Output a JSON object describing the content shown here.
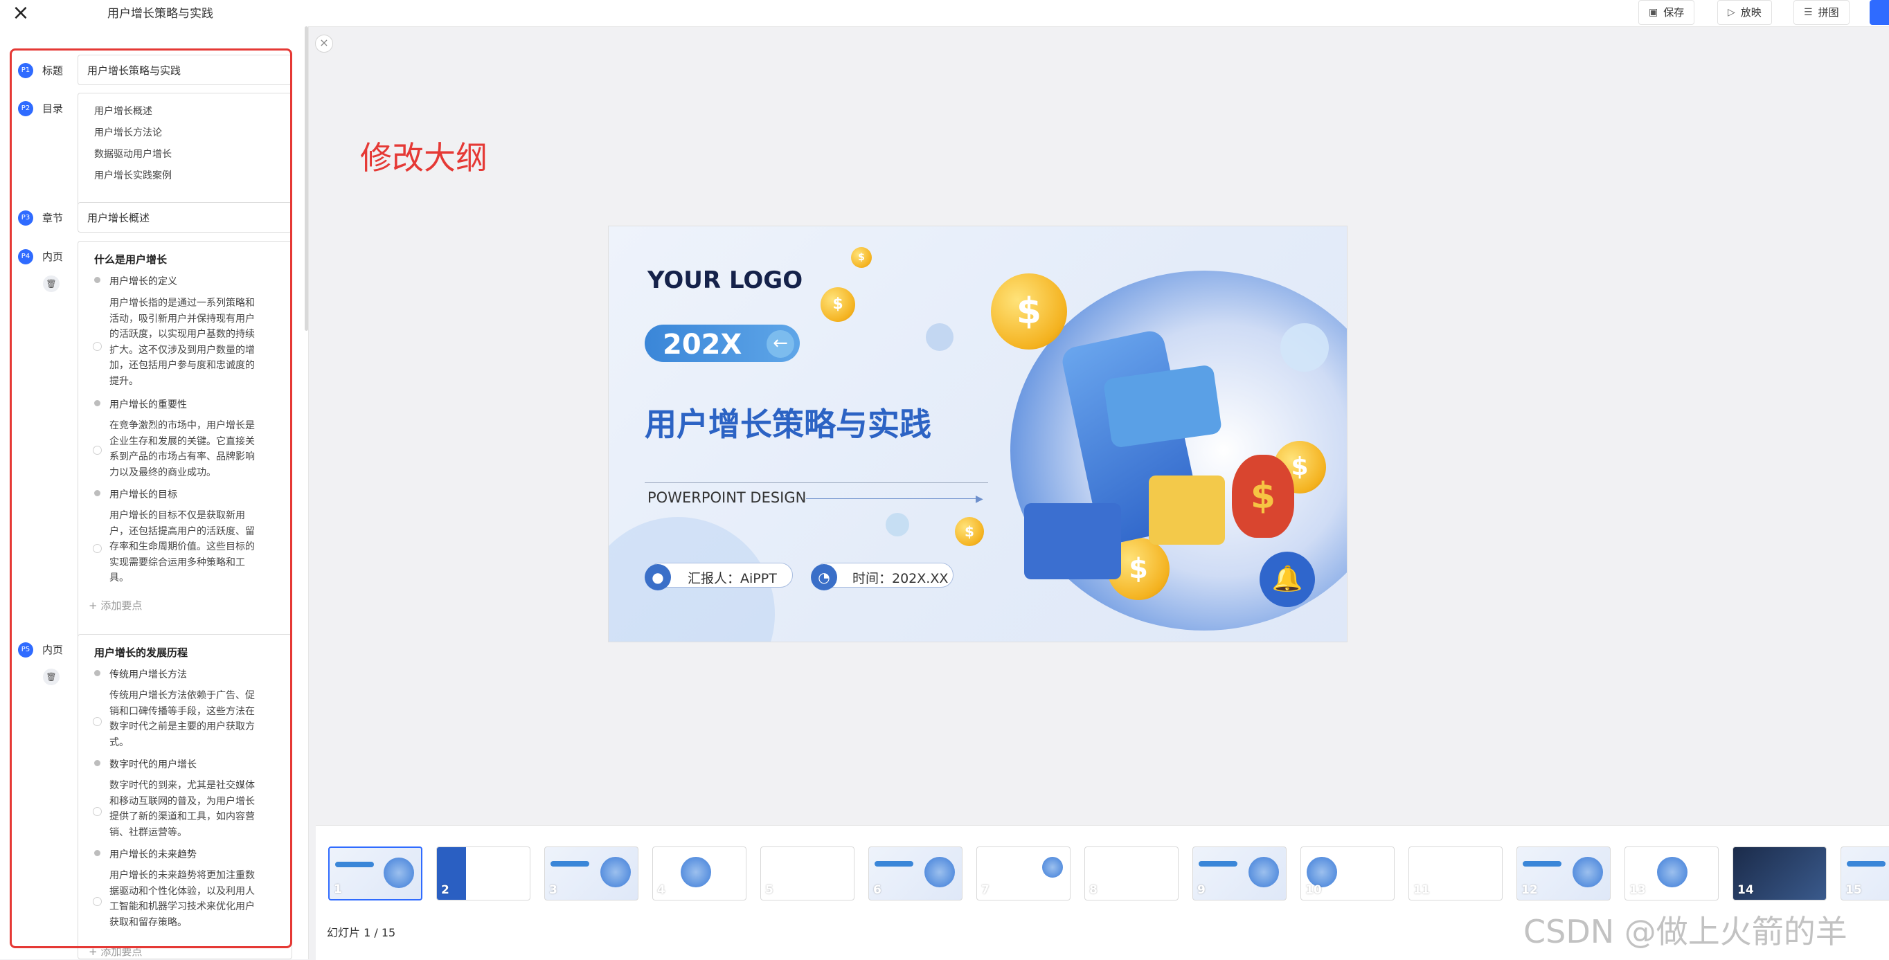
{
  "header": {
    "doc_title": "用户增长策略与实践",
    "buttons": {
      "save": "保存",
      "play": "放映",
      "layout": "拼图"
    }
  },
  "annotation": "修改大纲",
  "outline": {
    "title_item": {
      "badge": "P1",
      "kind": "标题",
      "value": "用户增长策略与实践"
    },
    "toc_item": {
      "badge": "P2",
      "kind": "目录",
      "items": [
        "用户增长概述",
        "用户增长方法论",
        "数据驱动用户增长",
        "用户增长实践案例"
      ]
    },
    "chapter_item": {
      "badge": "P3",
      "kind": "章节",
      "value": "用户增长概述"
    },
    "page4": {
      "badge": "P4",
      "kind": "内页",
      "title": "什么是用户增长",
      "points": [
        {
          "title": "用户增长的定义",
          "desc": [
            "用户增长指的是通过一系列策略和",
            "活动，吸引新用户并保持现有用户",
            "的活跃度，以实现用户基数的持续",
            "扩大。这不仅涉及到用户数量的增",
            "加，还包括用户参与度和忠诚度的",
            "提升。"
          ]
        },
        {
          "title": "用户增长的重要性",
          "desc": [
            "在竞争激烈的市场中，用户增长是",
            "企业生存和发展的关键。它直接关",
            "系到产品的市场占有率、品牌影响",
            "力以及最终的商业成功。"
          ]
        },
        {
          "title": "用户增长的目标",
          "desc": [
            "用户增长的目标不仅是获取新用",
            "户，还包括提高用户的活跃度、留",
            "存率和生命周期价值。这些目标的",
            "实现需要综合运用多种策略和工",
            "具。"
          ]
        }
      ],
      "add_point": "+ 添加要点"
    },
    "page5": {
      "badge": "P5",
      "kind": "内页",
      "title": "用户增长的发展历程",
      "points": [
        {
          "title": "传统用户增长方法",
          "desc": [
            "传统用户增长方法依赖于广告、促",
            "销和口碑传播等手段，这些方法在",
            "数字时代之前是主要的用户获取方",
            "式。"
          ]
        },
        {
          "title": "数字时代的用户增长",
          "desc": [
            "数字时代的到来，尤其是社交媒体",
            "和移动互联网的普及，为用户增长",
            "提供了新的渠道和工具，如内容营",
            "销、社群运营等。"
          ]
        },
        {
          "title": "用户增长的未来趋势",
          "desc": [
            "用户增长的未来趋势将更加注重数",
            "据驱动和个性化体验，以及利用人",
            "工智能和机器学习技术来优化用户",
            "获取和留存策略。"
          ]
        }
      ],
      "add_point": "+ 添加要点"
    }
  },
  "slide": {
    "logo": "YOUR LOGO",
    "year": "202X",
    "title": "用户增长策略与实践",
    "subtitle": "POWERPOINT DESIGN",
    "reporter": "汇报人：AiPPT",
    "time": "时间：202X.XX"
  },
  "thumbnails": [
    "1",
    "2",
    "3",
    "4",
    "5",
    "6",
    "7",
    "8",
    "9",
    "10",
    "11",
    "12",
    "13",
    "14",
    "15"
  ],
  "slide_counter": "幻灯片 1 / 15",
  "watermark": "CSDN @做上火箭的羊"
}
